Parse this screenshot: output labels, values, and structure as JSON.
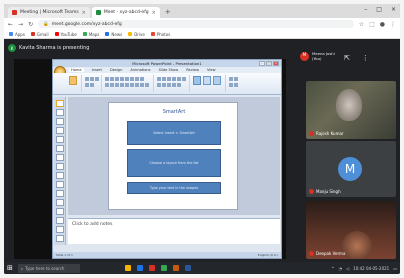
{
  "browser": {
    "tabs": [
      {
        "label": "Meeting | Microsoft Teams",
        "active": false,
        "color": "#d93025"
      },
      {
        "label": "Meet - xyz-abcd-efg",
        "active": true,
        "color": "#1e8e3e"
      }
    ],
    "new_tab": "+",
    "url": "meet.google.com/xyz-abcd-efg",
    "bookmarks": [
      {
        "label": "Apps",
        "color": "#4285f4"
      },
      {
        "label": "Gmail",
        "color": "#d93025"
      },
      {
        "label": "YouTube",
        "color": "#ff0000"
      },
      {
        "label": "Maps",
        "color": "#34a853"
      },
      {
        "label": "News",
        "color": "#1a73e8"
      },
      {
        "label": "Drive",
        "color": "#fbbc04"
      },
      {
        "label": "Photos",
        "color": "#ea4335"
      }
    ]
  },
  "meet": {
    "presenter_initial": "K",
    "presenter_status": "Kavita Sharma is presenting",
    "self_initial": "M",
    "self_label_line1": "Meena Joshi",
    "self_label_line2": "(You)",
    "participants": [
      {
        "name": "Rajesh Kumar"
      },
      {
        "name": "Manju Singh",
        "initial": "M"
      },
      {
        "name": "Deepak Verma"
      }
    ]
  },
  "ppt": {
    "window_title": "Microsoft PowerPoint - Presentation1",
    "ribbon_tabs": [
      "Home",
      "Insert",
      "Design",
      "Animations",
      "Slide Show",
      "Review",
      "View"
    ],
    "active_tab": "Home",
    "slide_title": "SmartArt",
    "boxes": [
      "Select Insert > SmartArt",
      "Choose a layout from the list",
      "Type your text in the shapes"
    ],
    "notes_placeholder": "Click to add notes",
    "status_left": "Slide 1 of 1",
    "status_right": "English (U.S.)"
  },
  "taskbar": {
    "start": "⊞",
    "search_placeholder": "Type here to search",
    "apps": [
      "#f5b400",
      "#1a73e8",
      "#d93025",
      "#34a853",
      "#c55a11",
      "#2b579a"
    ],
    "time": "10:42",
    "date": "04-05-2021"
  }
}
